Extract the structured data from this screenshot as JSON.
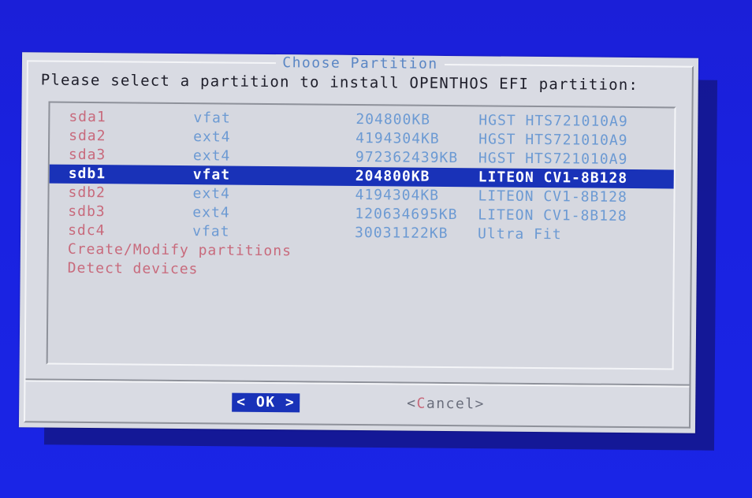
{
  "dialog": {
    "title": "Choose Partition",
    "prompt": "Please select a partition to install OPENTHOS EFI partition:"
  },
  "partitions": [
    {
      "device": "sda1",
      "fs": "vfat",
      "size": "204800KB",
      "model": "HGST HTS721010A9"
    },
    {
      "device": "sda2",
      "fs": "ext4",
      "size": "4194304KB",
      "model": "HGST HTS721010A9"
    },
    {
      "device": "sda3",
      "fs": "ext4",
      "size": "972362439KB",
      "model": "HGST HTS721010A9"
    },
    {
      "device": "sdb1",
      "fs": "vfat",
      "size": "204800KB",
      "model": "LITEON CV1-8B128"
    },
    {
      "device": "sdb2",
      "fs": "ext4",
      "size": "4194304KB",
      "model": "LITEON CV1-8B128"
    },
    {
      "device": "sdb3",
      "fs": "ext4",
      "size": "120634695KB",
      "model": "LITEON CV1-8B128"
    },
    {
      "device": "sdc4",
      "fs": "vfat",
      "size": "30031122KB",
      "model": "Ultra Fit"
    }
  ],
  "selected_index": 3,
  "actions": [
    {
      "label": "Create/Modify partitions"
    },
    {
      "label": "Detect devices"
    }
  ],
  "buttons": {
    "ok": "< OK >",
    "cancel_open": "<",
    "cancel_hot": "C",
    "cancel_rest": "ancel>"
  },
  "colors": {
    "background": "#1a22e0",
    "dialog": "#d9dbe3",
    "selection": "#1932b8",
    "hotkey": "#c86a7c",
    "column_text": "#6c9ad3"
  }
}
